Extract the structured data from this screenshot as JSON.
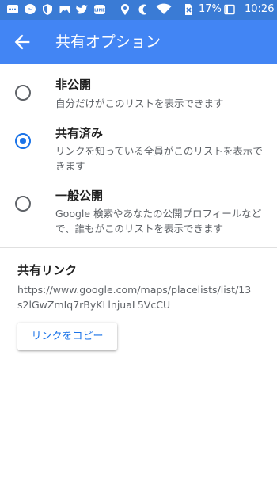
{
  "status_bar": {
    "battery": "17%",
    "time": "10:26",
    "icons": [
      "messages-icon",
      "messenger-icon",
      "shield-icon",
      "image-icon",
      "twitter-icon",
      "line-icon",
      "location-icon",
      "moon-icon",
      "wifi-icon",
      "no-sim-icon",
      "battery-icon"
    ]
  },
  "app_bar": {
    "title": "共有オプション",
    "back_icon": "arrow-back-icon"
  },
  "options": [
    {
      "title": "非公開",
      "description": "自分だけがこのリストを表示できます",
      "selected": false
    },
    {
      "title": "共有済み",
      "description": "リンクを知っている全員がこのリストを表示できます",
      "selected": true
    },
    {
      "title": "一般公開",
      "description": "Google 検索やあなたの公開プロフィールなどで、誰もがこのリストを表示できます",
      "selected": false
    }
  ],
  "share_link": {
    "heading": "共有リンク",
    "url": "https://www.google.com/maps/placelists/list/13s2lGwZmIq7rByKLlnjuaL5VcCU",
    "copy_button_label": "リンクをコピー"
  },
  "colors": {
    "status_bar": "#3a7bd5",
    "app_bar": "#4285f4",
    "accent": "#1a73e8"
  }
}
